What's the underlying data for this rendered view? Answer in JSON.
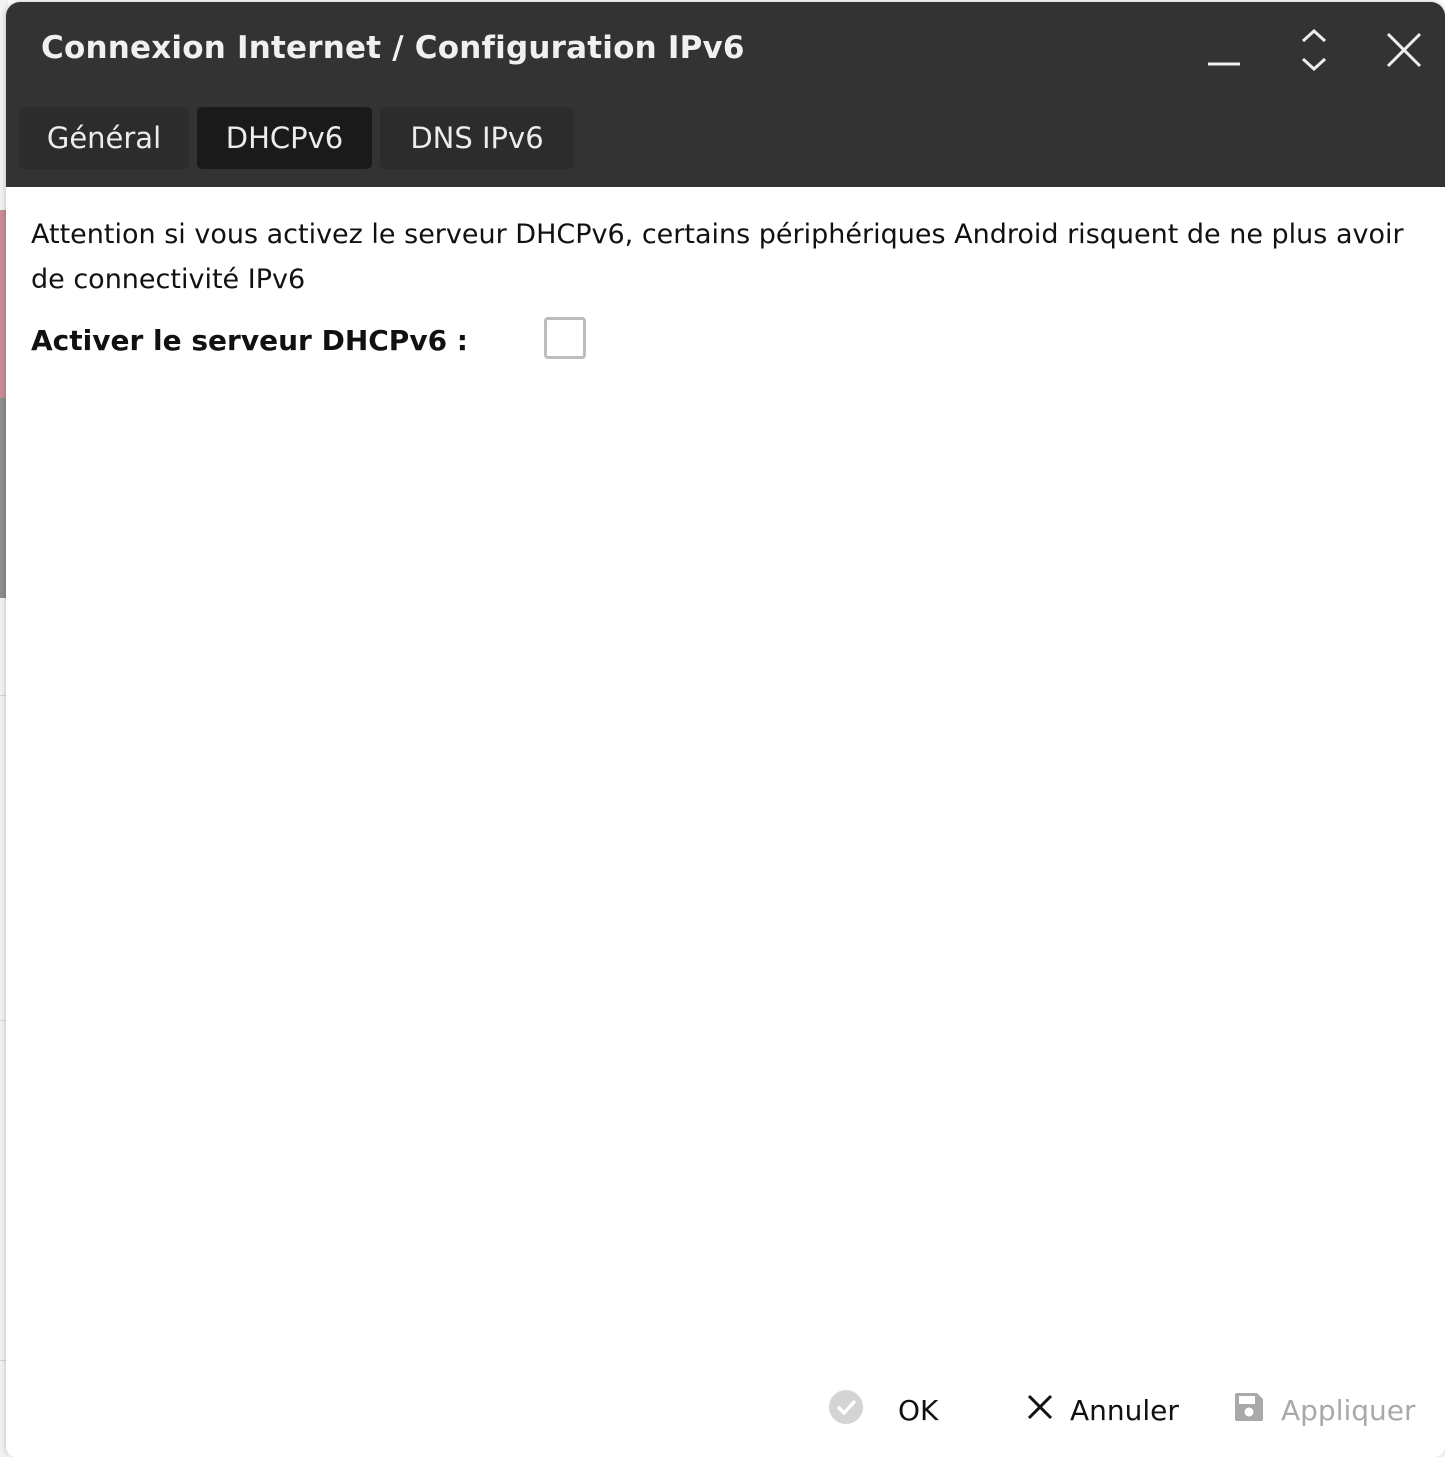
{
  "window": {
    "title": "Connexion Internet / Configuration IPv6"
  },
  "tabs": [
    {
      "label": "Général",
      "active": false
    },
    {
      "label": "DHCPv6",
      "active": true
    },
    {
      "label": "DNS IPv6",
      "active": false
    }
  ],
  "content": {
    "warning": "Attention si vous activez le serveur DHCPv6, certains périphériques Android risquent de ne plus avoir de connectivité IPv6",
    "enable_dhcp_label": "Activer le serveur DHCPv6 :",
    "enable_dhcp_checked": false
  },
  "footer": {
    "ok_label": "OK",
    "cancel_label": "Annuler",
    "apply_label": "Appliquer"
  },
  "icons": {
    "minimize": "minimize-icon",
    "maximize": "expand-collapse-icon",
    "close": "close-icon",
    "ok": "check-circle-icon",
    "cancel": "x-icon",
    "apply": "floppy-disk-icon"
  },
  "colors": {
    "header_bg": "#333333",
    "tab_bg": "#2c2c2c",
    "tab_active_bg": "#1a1a1a",
    "disabled_text": "#a9a9a9"
  }
}
